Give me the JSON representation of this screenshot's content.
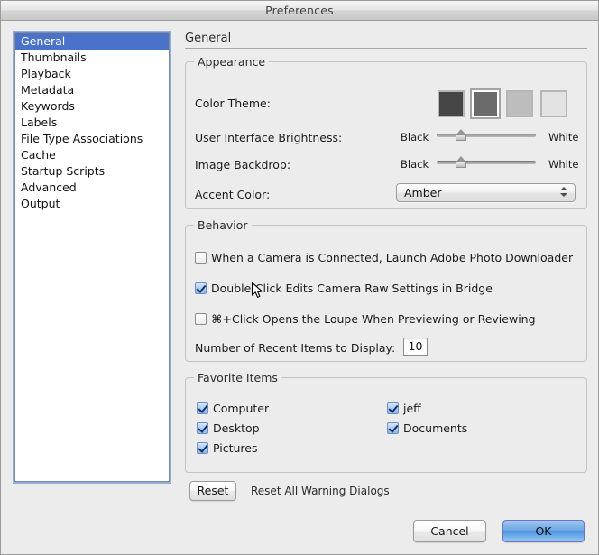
{
  "window": {
    "title": "Preferences"
  },
  "sidebar": {
    "items": [
      {
        "label": "General",
        "selected": true
      },
      {
        "label": "Thumbnails",
        "selected": false
      },
      {
        "label": "Playback",
        "selected": false
      },
      {
        "label": "Metadata",
        "selected": false
      },
      {
        "label": "Keywords",
        "selected": false
      },
      {
        "label": "Labels",
        "selected": false
      },
      {
        "label": "File Type Associations",
        "selected": false
      },
      {
        "label": "Cache",
        "selected": false
      },
      {
        "label": "Startup Scripts",
        "selected": false
      },
      {
        "label": "Advanced",
        "selected": false
      },
      {
        "label": "Output",
        "selected": false
      }
    ]
  },
  "panel": {
    "title": "General",
    "appearance": {
      "legend": "Appearance",
      "color_theme_label": "Color Theme:",
      "swatches": [
        {
          "color": "#454545",
          "selected": false
        },
        {
          "color": "#6b6b6b",
          "selected": true
        },
        {
          "color": "#bdbdbd",
          "selected": false
        },
        {
          "color": "#e3e3e3",
          "selected": false
        }
      ],
      "ui_brightness_label": "User Interface Brightness:",
      "ui_brightness_min": "Black",
      "ui_brightness_max": "White",
      "ui_brightness_value": 22,
      "image_backdrop_label": "Image Backdrop:",
      "image_backdrop_min": "Black",
      "image_backdrop_max": "White",
      "image_backdrop_value": 22,
      "accent_color_label": "Accent Color:",
      "accent_color_value": "Amber"
    },
    "behavior": {
      "legend": "Behavior",
      "checkboxes": [
        {
          "label": "When a Camera is Connected, Launch Adobe Photo Downloader",
          "checked": false
        },
        {
          "label": "Double-Click Edits Camera Raw Settings in Bridge",
          "checked": true
        },
        {
          "label": "⌘+Click Opens the Loupe When Previewing or Reviewing",
          "checked": false
        }
      ],
      "recent_items_label": "Number of Recent Items to Display:",
      "recent_items_value": "10"
    },
    "favorites": {
      "legend": "Favorite Items",
      "left_column": [
        {
          "label": "Computer",
          "checked": true
        },
        {
          "label": "Desktop",
          "checked": true
        },
        {
          "label": "Pictures",
          "checked": true
        }
      ],
      "right_column": [
        {
          "label": "jeff",
          "checked": true
        },
        {
          "label": "Documents",
          "checked": true
        }
      ]
    }
  },
  "footer": {
    "reset_label": "Reset",
    "reset_note": "Reset All Warning Dialogs",
    "cancel_label": "Cancel",
    "ok_label": "OK"
  },
  "colors": {
    "selection_blue": "#4a72c8",
    "window_bg": "#ececec",
    "primary_button": "#6ea8e6"
  }
}
